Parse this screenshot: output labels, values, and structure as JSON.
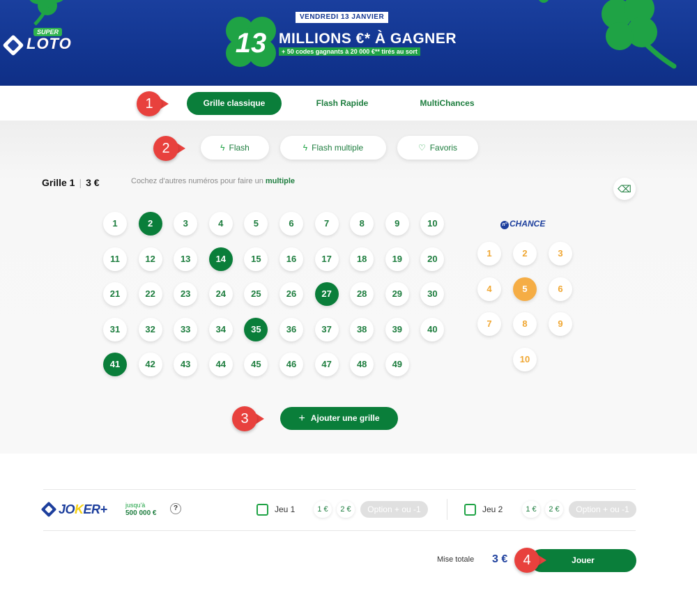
{
  "banner": {
    "logo_super": "SUPER",
    "logo_loto": "LOTO",
    "promo_date": "VENDREDI 13 JANVIER",
    "promo_number": "13",
    "promo_main": "MILLIONS €* À GAGNER",
    "promo_sub": "+ 50 codes gagnants à 20 000 €** tirés au sort"
  },
  "tabs": [
    {
      "label": "Grille classique",
      "active": true
    },
    {
      "label": "Flash Rapide",
      "active": false
    },
    {
      "label": "MultiChances",
      "active": false
    }
  ],
  "modes": [
    {
      "label": "Flash",
      "icon": "lightning-icon"
    },
    {
      "label": "Flash multiple",
      "icon": "double-lightning-icon"
    },
    {
      "label": "Favoris",
      "icon": "heart-icon"
    }
  ],
  "grid": {
    "title": "Grille 1",
    "price": "3 €",
    "hint": "Cochez d'autres numéros pour faire un ",
    "hint_link": "multiple",
    "numbers": [
      "1",
      "2",
      "3",
      "4",
      "5",
      "6",
      "7",
      "8",
      "9",
      "10",
      "11",
      "12",
      "13",
      "14",
      "15",
      "16",
      "17",
      "18",
      "19",
      "20",
      "21",
      "22",
      "23",
      "24",
      "25",
      "26",
      "27",
      "28",
      "29",
      "30",
      "31",
      "32",
      "33",
      "34",
      "35",
      "36",
      "37",
      "38",
      "39",
      "40",
      "41",
      "42",
      "43",
      "44",
      "45",
      "46",
      "47",
      "48",
      "49"
    ],
    "selected": [
      2,
      14,
      27,
      35,
      41
    ],
    "chance_logo_prefix": "n°",
    "chance_logo": "CHANCE",
    "chance_numbers": [
      "1",
      "2",
      "3",
      "4",
      "5",
      "6",
      "7",
      "8",
      "9",
      "10"
    ],
    "chance_selected": [
      5
    ],
    "add_grid_label": "Ajouter une grille"
  },
  "callouts": [
    "1",
    "2",
    "3",
    "4"
  ],
  "joker": {
    "logo_text_a": "JO",
    "logo_text_k": "K",
    "logo_text_b": "ER+",
    "jusqua": "jusqu'à",
    "jackpot": "500 000 €",
    "help": "?",
    "jeu1": {
      "label": "Jeu 1",
      "opt1": "1 €",
      "opt2": "2 €",
      "option": "Option + ou -1"
    },
    "jeu2": {
      "label": "Jeu 2",
      "opt1": "1 €",
      "opt2": "2 €",
      "option": "Option + ou -1"
    }
  },
  "footer": {
    "mise_label": "Mise totale",
    "mise_value": "3 €",
    "play_label": "Jouer"
  },
  "colors": {
    "brand_blue": "#123590",
    "green": "#0a7e3a",
    "chance_orange": "#f5ad45",
    "callout_red": "#e8413d"
  }
}
